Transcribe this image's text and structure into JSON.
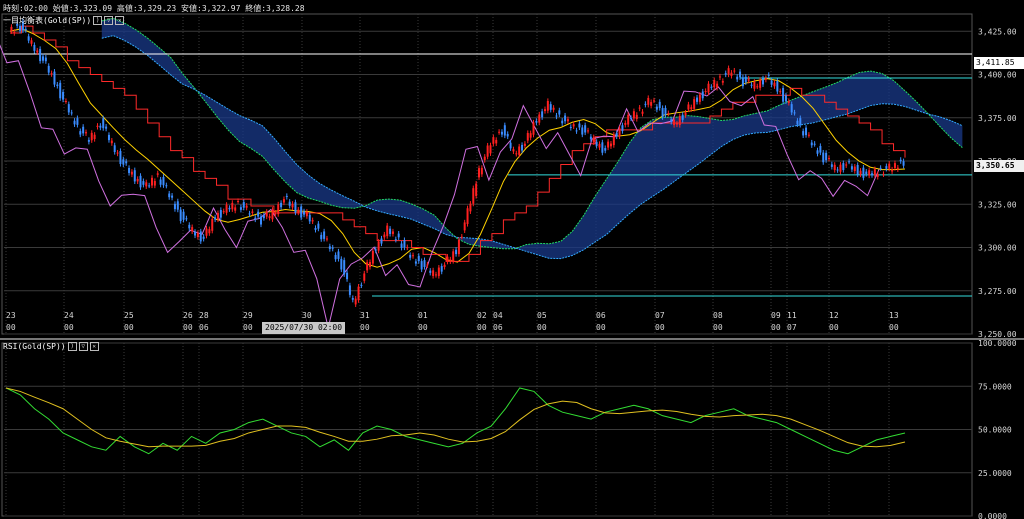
{
  "header": {
    "ohlc_text": "時刻:02:00 始値:3,323.09 高値:3,329.23 安値:3,322.97 終値:3,328.28",
    "main_indicator": "一目均衡表(Gold(SP))",
    "sub_indicator": "RSI(Gold(SP))",
    "cursor_time": "2025/07/30 02:00"
  },
  "axis_labels": {
    "price_ticks": [
      "3,425.00",
      "3,400.00",
      "3,375.00",
      "3,350.00",
      "3,325.00",
      "3,300.00",
      "3,275.00",
      "3,250.00"
    ],
    "rsi_ticks": [
      "100.0000",
      "75.0000",
      "50.0000",
      "25.0000",
      "0.0000"
    ],
    "date_labels": [
      {
        "day": "23",
        "hour": "00"
      },
      {
        "day": "24",
        "hour": "00"
      },
      {
        "day": "25",
        "hour": "00"
      },
      {
        "day": "26",
        "hour": "00"
      },
      {
        "day": "28",
        "hour": "06"
      },
      {
        "day": "29",
        "hour": "00"
      },
      {
        "day": "30",
        "hour": "00"
      },
      {
        "day": "31",
        "hour": "00"
      },
      {
        "day": "01",
        "hour": "00"
      },
      {
        "day": "02",
        "hour": "00"
      },
      {
        "day": "04",
        "hour": "06"
      },
      {
        "day": "05",
        "hour": "00"
      },
      {
        "day": "06",
        "hour": "00"
      },
      {
        "day": "07",
        "hour": "00"
      },
      {
        "day": "08",
        "hour": "00"
      },
      {
        "day": "09",
        "hour": "00"
      },
      {
        "day": "11",
        "hour": "07"
      },
      {
        "day": "12",
        "hour": "00"
      },
      {
        "day": "13",
        "hour": "00"
      }
    ]
  },
  "price_lines": {
    "white_level": "3,411.85",
    "current_price": "3,350.65"
  },
  "colors": {
    "background": "#000000",
    "bull_candle": "#ff2020",
    "bear_candle": "#3a8cff",
    "kijun": "#ff2a2a",
    "tenkan": "#ffd200",
    "chikou": "#d070e0",
    "span_a": "#22dd66",
    "span_b": "#33aaff",
    "kumo_fill": "#1a3a8a",
    "rsi": "#33dd33",
    "rsi_signal": "#e0c020",
    "hline_cyan": "#33dddd",
    "grid": "#3a3a3a"
  },
  "chart_data": {
    "type": "line",
    "instrument": "Gold(SP)",
    "price_axis": {
      "ylim": [
        3250,
        3435
      ]
    },
    "rsi_axis": {
      "ylim": [
        0,
        100
      ]
    },
    "x_dates": [
      "23",
      "24",
      "25",
      "26",
      "28",
      "29",
      "30",
      "31",
      "01",
      "02",
      "04",
      "05",
      "06",
      "07",
      "08",
      "09",
      "11",
      "12",
      "13"
    ],
    "close_path": [
      3425,
      3428,
      3418,
      3408,
      3396,
      3382,
      3370,
      3362,
      3372,
      3360,
      3348,
      3340,
      3335,
      3342,
      3330,
      3318,
      3310,
      3305,
      3318,
      3322,
      3326,
      3320,
      3316,
      3320,
      3328,
      3322,
      3318,
      3310,
      3300,
      3290,
      3268,
      3285,
      3300,
      3310,
      3305,
      3295,
      3290,
      3285,
      3290,
      3298,
      3320,
      3345,
      3360,
      3368,
      3355,
      3360,
      3374,
      3382,
      3376,
      3370,
      3368,
      3362,
      3356,
      3366,
      3374,
      3380,
      3385,
      3378,
      3372,
      3378,
      3386,
      3392,
      3398,
      3402,
      3396,
      3394,
      3398,
      3392,
      3382,
      3370,
      3360,
      3352,
      3346,
      3348,
      3344,
      3342,
      3345,
      3346,
      3350
    ],
    "horizontal_levels": [
      3411.85,
      3398,
      3342,
      3272
    ],
    "rsi_path": [
      74,
      70,
      62,
      56,
      48,
      44,
      40,
      38,
      46,
      40,
      36,
      42,
      38,
      46,
      42,
      48,
      50,
      54,
      56,
      52,
      48,
      46,
      40,
      44,
      38,
      48,
      52,
      50,
      46,
      44,
      42,
      40,
      42,
      48,
      52,
      62,
      74,
      72,
      64,
      60,
      58,
      56,
      60,
      62,
      64,
      62,
      58,
      56,
      54,
      58,
      60,
      62,
      58,
      56,
      54,
      50,
      46,
      42,
      38,
      36,
      40,
      44,
      46,
      48
    ]
  }
}
